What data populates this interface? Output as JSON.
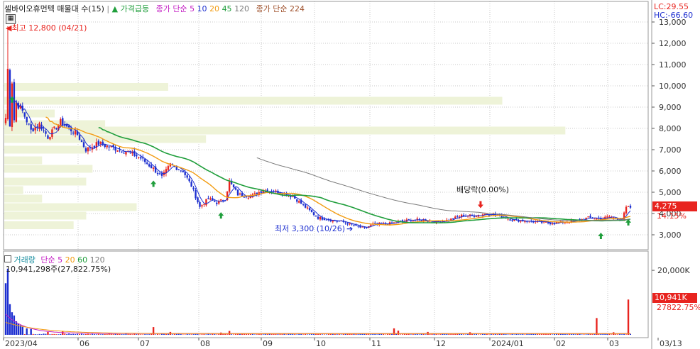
{
  "colors": {
    "up": "#e8241f",
    "down": "#1d2fd0",
    "ma5": "#1d2fd0",
    "ma10": "#1d2fd0",
    "ma20": "#f29c12",
    "ma45": "#1f9e3b",
    "ma120": "#7a7a7a",
    "ma224": "#7a7a7a",
    "profile": "#eef3d8",
    "volma5": "#c41ec4",
    "volma20": "#f29c12",
    "volma60": "#1f9e3b",
    "grid": "#c8c8c8",
    "price_badge": "#e8241f",
    "vol_badge": "#e8241f"
  },
  "header": {
    "title": "셀바이오휴먼텍 매물대 수(15)",
    "legend_price_surge": "가격급등",
    "legend_close_ma_prefix": "종가 단순",
    "ma_periods": [
      "5",
      "10",
      "20",
      "45",
      "120"
    ],
    "legend_close_ma224": "종가 단순 224"
  },
  "right_header": {
    "lc": "LC:29.55",
    "hc": "HC:-66.60"
  },
  "annotations": {
    "high": "최고 12,800 (04/21)",
    "low": "최저 3,300 (10/26)",
    "dividend": "배당락(0.00%)"
  },
  "price_badge": {
    "price": "4,275",
    "change": "14.15%"
  },
  "volume_header": {
    "title": "거래량",
    "ma_prefix": "단순",
    "periods": [
      "5",
      "20",
      "60",
      "120"
    ],
    "last": "10,941,298주(27,822.75%)"
  },
  "volume_badge": {
    "value": "10,941K",
    "pct": "27822.75%"
  },
  "chart_data": [
    {
      "type": "candlestick",
      "title": "셀바이오휴먼텍 매물대 수(15)",
      "y_ticks": [
        "3,000",
        "4,000",
        "5,000",
        "6,000",
        "7,000",
        "8,000",
        "9,000",
        "10,000",
        "11,000",
        "12,000",
        "13,000"
      ],
      "ylim": [
        2300,
        13300
      ],
      "x_ticks": [
        "2023/04",
        "06",
        "07",
        "08",
        "09",
        "10",
        "11",
        "12",
        "2024/01",
        "02",
        "03",
        "03/13"
      ],
      "series": [
        {
          "name": "종가 단순 5",
          "period": 5
        },
        {
          "name": "종가 단순 10",
          "period": 10
        },
        {
          "name": "종가 단순 20",
          "period": 20
        },
        {
          "name": "종가 단순 45",
          "period": 45
        },
        {
          "name": "종가 단순 120",
          "period": 120
        },
        {
          "name": "종가 단순 224",
          "period": 224
        }
      ],
      "control_points": [
        [
          0,
          8500
        ],
        [
          1,
          12800
        ],
        [
          2,
          8200
        ],
        [
          3,
          10200
        ],
        [
          4,
          8400
        ],
        [
          5,
          9200
        ],
        [
          8,
          8800
        ],
        [
          12,
          7900
        ],
        [
          16,
          8200
        ],
        [
          20,
          7600
        ],
        [
          26,
          8300
        ],
        [
          30,
          8000
        ],
        [
          34,
          7700
        ],
        [
          38,
          7000
        ],
        [
          44,
          7300
        ],
        [
          50,
          7100
        ],
        [
          58,
          6900
        ],
        [
          64,
          6600
        ],
        [
          70,
          6100
        ],
        [
          74,
          5700
        ],
        [
          78,
          6300
        ],
        [
          84,
          6000
        ],
        [
          88,
          5300
        ],
        [
          92,
          4300
        ],
        [
          96,
          4700
        ],
        [
          100,
          4500
        ],
        [
          104,
          4700
        ],
        [
          106,
          5500
        ],
        [
          110,
          4900
        ],
        [
          116,
          4800
        ],
        [
          122,
          5100
        ],
        [
          130,
          5000
        ],
        [
          136,
          4800
        ],
        [
          142,
          4300
        ],
        [
          148,
          3800
        ],
        [
          154,
          3700
        ],
        [
          160,
          3600
        ],
        [
          166,
          3400
        ],
        [
          170,
          3300
        ],
        [
          174,
          3500
        ],
        [
          180,
          3500
        ],
        [
          186,
          3600
        ],
        [
          192,
          3700
        ],
        [
          198,
          3700
        ],
        [
          204,
          3600
        ],
        [
          210,
          3700
        ],
        [
          216,
          3900
        ],
        [
          222,
          3900
        ],
        [
          228,
          4000
        ],
        [
          234,
          3900
        ],
        [
          240,
          3700
        ],
        [
          246,
          3650
        ],
        [
          252,
          3600
        ],
        [
          258,
          3550
        ],
        [
          264,
          3600
        ],
        [
          270,
          3650
        ],
        [
          276,
          3800
        ],
        [
          282,
          3750
        ],
        [
          286,
          3850
        ],
        [
          292,
          3700
        ],
        [
          294,
          4275
        ]
      ],
      "profile_levels": [
        {
          "price": 9950,
          "weight": 0.26
        },
        {
          "price": 9300,
          "weight": 0.79
        },
        {
          "price": 8700,
          "weight": 0.08
        },
        {
          "price": 8200,
          "weight": 0.16
        },
        {
          "price": 7900,
          "weight": 0.89
        },
        {
          "price": 7500,
          "weight": 0.32
        },
        {
          "price": 7000,
          "weight": 0.13
        },
        {
          "price": 6500,
          "weight": 0.06
        },
        {
          "price": 6100,
          "weight": 0.14
        },
        {
          "price": 5500,
          "weight": 0.13
        },
        {
          "price": 5100,
          "weight": 0.03
        },
        {
          "price": 4700,
          "weight": 0.06
        },
        {
          "price": 4300,
          "weight": 0.21
        },
        {
          "price": 3900,
          "weight": 0.13
        },
        {
          "price": 3450,
          "weight": 0.11
        }
      ],
      "surge_markers": [
        3,
        70,
        102,
        282,
        295
      ],
      "dividend_index": 225,
      "high_index": 1,
      "low_index": 170
    },
    {
      "type": "bar",
      "title": "거래량",
      "y_ticks": [
        "20,000K"
      ],
      "ylim": [
        0,
        22000
      ],
      "spikes": [
        {
          "i": 0,
          "v": 16000
        },
        {
          "i": 1,
          "v": 20500
        },
        {
          "i": 2,
          "v": 9500
        },
        {
          "i": 3,
          "v": 7000
        },
        {
          "i": 4,
          "v": 6000
        },
        {
          "i": 5,
          "v": 4200
        },
        {
          "i": 6,
          "v": 3500
        },
        {
          "i": 7,
          "v": 3000
        },
        {
          "i": 8,
          "v": 2500
        },
        {
          "i": 10,
          "v": 2000
        },
        {
          "i": 12,
          "v": 1800
        },
        {
          "i": 20,
          "v": 900
        },
        {
          "i": 27,
          "v": 1200
        },
        {
          "i": 70,
          "v": 2400
        },
        {
          "i": 78,
          "v": 900
        },
        {
          "i": 102,
          "v": 700
        },
        {
          "i": 106,
          "v": 1200
        },
        {
          "i": 184,
          "v": 2000
        },
        {
          "i": 186,
          "v": 1300
        },
        {
          "i": 200,
          "v": 900
        },
        {
          "i": 220,
          "v": 800
        },
        {
          "i": 280,
          "v": 5200
        },
        {
          "i": 288,
          "v": 800
        },
        {
          "i": 295,
          "v": 10941
        }
      ]
    }
  ]
}
